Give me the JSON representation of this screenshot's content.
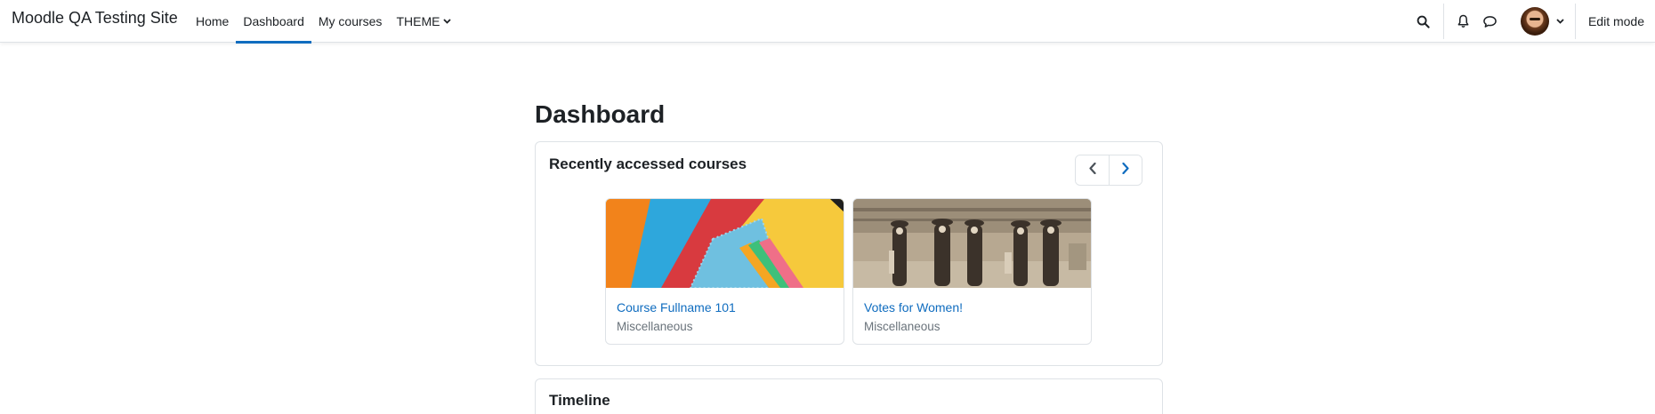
{
  "site": {
    "name": "Moodle QA Testing Site"
  },
  "nav": {
    "items": [
      {
        "label": "Home"
      },
      {
        "label": "Dashboard"
      },
      {
        "label": "My courses"
      },
      {
        "label": "THEME"
      }
    ],
    "active": "Dashboard",
    "edit_mode_label": "Edit mode",
    "icons": [
      "search-icon",
      "bell-icon",
      "chat-icon",
      "user-avatar",
      "chevron-down-icon"
    ]
  },
  "page": {
    "title": "Dashboard"
  },
  "recent": {
    "title": "Recently accessed courses",
    "prev_icon": "chevron-left-icon",
    "next_icon": "chevron-right-icon",
    "courses": [
      {
        "name": "Course Fullname 101",
        "category": "Miscellaneous",
        "image": "colorful-folders-and-pens"
      },
      {
        "name": "Votes for Women!",
        "category": "Miscellaneous",
        "image": "sepia-photo-of-women"
      }
    ]
  },
  "timeline": {
    "title": "Timeline"
  },
  "colors": {
    "link": "#0f6cbf",
    "active_underline": "#0f6cbf",
    "text": "#1d2125",
    "muted": "#6a737b",
    "border": "#dee2e6"
  }
}
